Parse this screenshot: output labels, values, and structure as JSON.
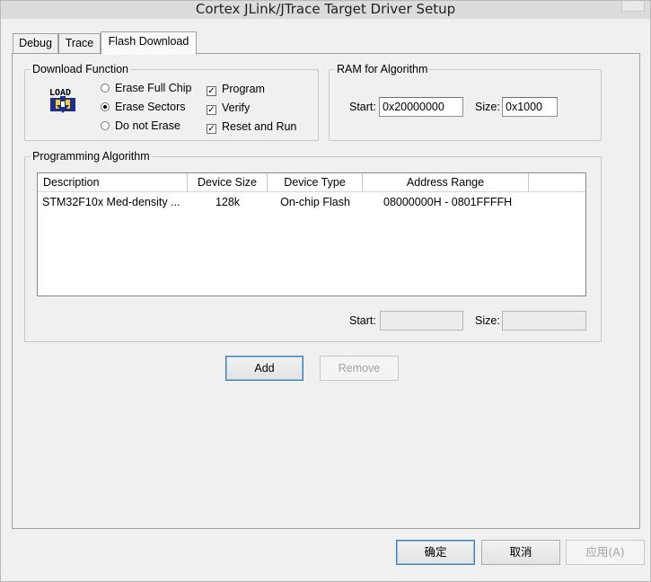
{
  "window": {
    "title": "Cortex JLink/JTrace Target Driver Setup"
  },
  "tabs": [
    {
      "label": "Debug"
    },
    {
      "label": "Trace"
    },
    {
      "label": "Flash Download"
    }
  ],
  "download_function": {
    "title": "Download Function",
    "icon_text": "LOAD",
    "erase_options": [
      {
        "label": "Erase Full Chip",
        "selected": false
      },
      {
        "label": "Erase Sectors",
        "selected": true
      },
      {
        "label": "Do not Erase",
        "selected": false
      }
    ],
    "checks": [
      {
        "label": "Program",
        "checked": true
      },
      {
        "label": "Verify",
        "checked": true
      },
      {
        "label": "Reset and Run",
        "checked": true
      }
    ]
  },
  "ram": {
    "title": "RAM for Algorithm",
    "start_label": "Start:",
    "start_value": "0x20000000",
    "size_label": "Size:",
    "size_value": "0x1000"
  },
  "programming": {
    "title": "Programming Algorithm",
    "columns": [
      "Description",
      "Device Size",
      "Device Type",
      "Address Range"
    ],
    "rows": [
      [
        "STM32F10x Med-density ...",
        "128k",
        "On-chip Flash",
        "08000000H - 0801FFFFH"
      ]
    ],
    "start_label": "Start:",
    "start_value": "",
    "size_label": "Size:",
    "size_value": ""
  },
  "buttons": {
    "add": "Add",
    "remove": "Remove",
    "ok": "确定",
    "cancel": "取消",
    "apply": "应用(A)"
  }
}
